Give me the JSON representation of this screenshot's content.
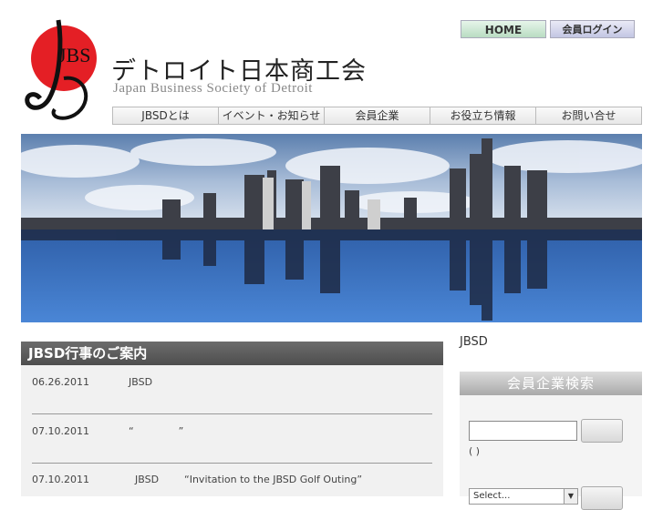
{
  "header": {
    "logo_text": "JBS",
    "title": "デトロイト日本商工会",
    "subtitle": "Japan Business Society of Detroit",
    "home_label": "HOME",
    "login_label": "会員ログイン"
  },
  "nav": {
    "items": [
      {
        "label": "JBSDとは"
      },
      {
        "label": "イベント・お知らせ"
      },
      {
        "label": "会員企業"
      },
      {
        "label": "お役立ち情報"
      },
      {
        "label": "お問い合せ"
      }
    ]
  },
  "events": {
    "title": "JBSD行事のご案内",
    "items": [
      {
        "date": "06.26.2011",
        "text": "JBSD"
      },
      {
        "date": "07.10.2011",
        "text": "“              ”"
      },
      {
        "date": "07.10.2011",
        "text": "  JBSD        “Invitation to the JBSD Golf Outing”"
      }
    ]
  },
  "sidebar": {
    "label": "JBSD",
    "search": {
      "title": "会員企業検索",
      "input_value": "",
      "note": "(   )",
      "select_value": "Select..."
    }
  },
  "colors": {
    "events_header": "#555555",
    "home_button": "#c8e6cf",
    "login_button": "#d2d4ec"
  }
}
